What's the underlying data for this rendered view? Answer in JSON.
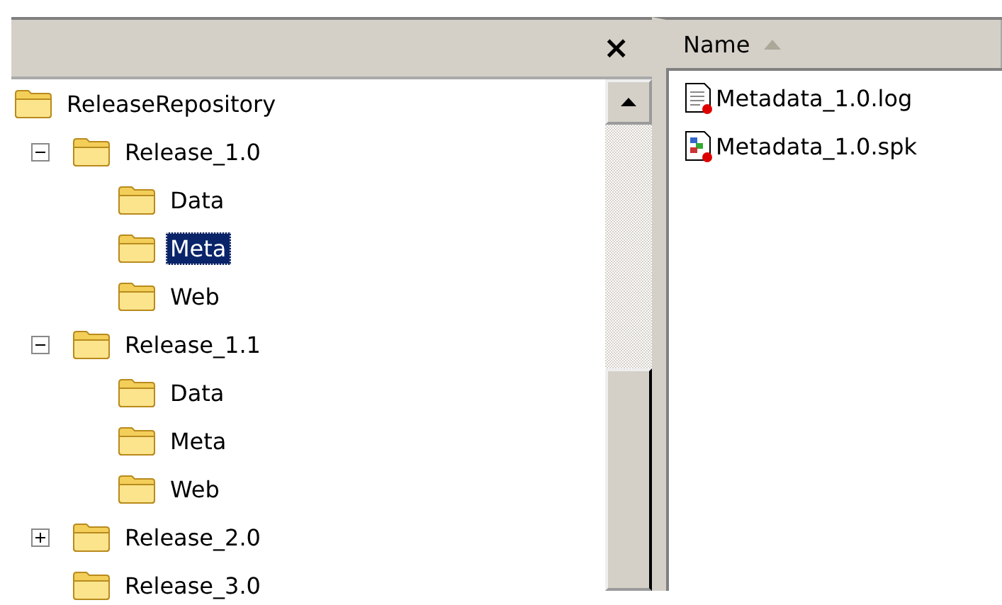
{
  "tree_pane": {
    "close_label": "×",
    "tree": [
      {
        "label": "ReleaseRepository",
        "selected": false,
        "children": [
          {
            "label": "Release_1.0",
            "kind": "branch",
            "expanded": true,
            "selected": false,
            "children": [
              {
                "label": "Data",
                "selected": false
              },
              {
                "label": "Meta",
                "selected": true
              },
              {
                "label": "Web",
                "selected": false
              }
            ]
          },
          {
            "label": "Release_1.1",
            "kind": "branch",
            "expanded": true,
            "selected": false,
            "children": [
              {
                "label": "Data",
                "selected": false
              },
              {
                "label": "Meta",
                "selected": false
              },
              {
                "label": "Web",
                "selected": false
              }
            ]
          },
          {
            "label": "Release_2.0",
            "kind": "branch",
            "expanded": false,
            "selected": false
          },
          {
            "label": "Release_3.0",
            "kind": "leaf",
            "selected": false
          }
        ]
      }
    ]
  },
  "file_pane": {
    "columns": [
      {
        "label": "Name",
        "sorted": true,
        "ascending": true
      }
    ],
    "files": [
      {
        "name": "Metadata_1.0.log",
        "kind": "log"
      },
      {
        "name": "Metadata_1.0.spk",
        "kind": "spk"
      }
    ]
  }
}
